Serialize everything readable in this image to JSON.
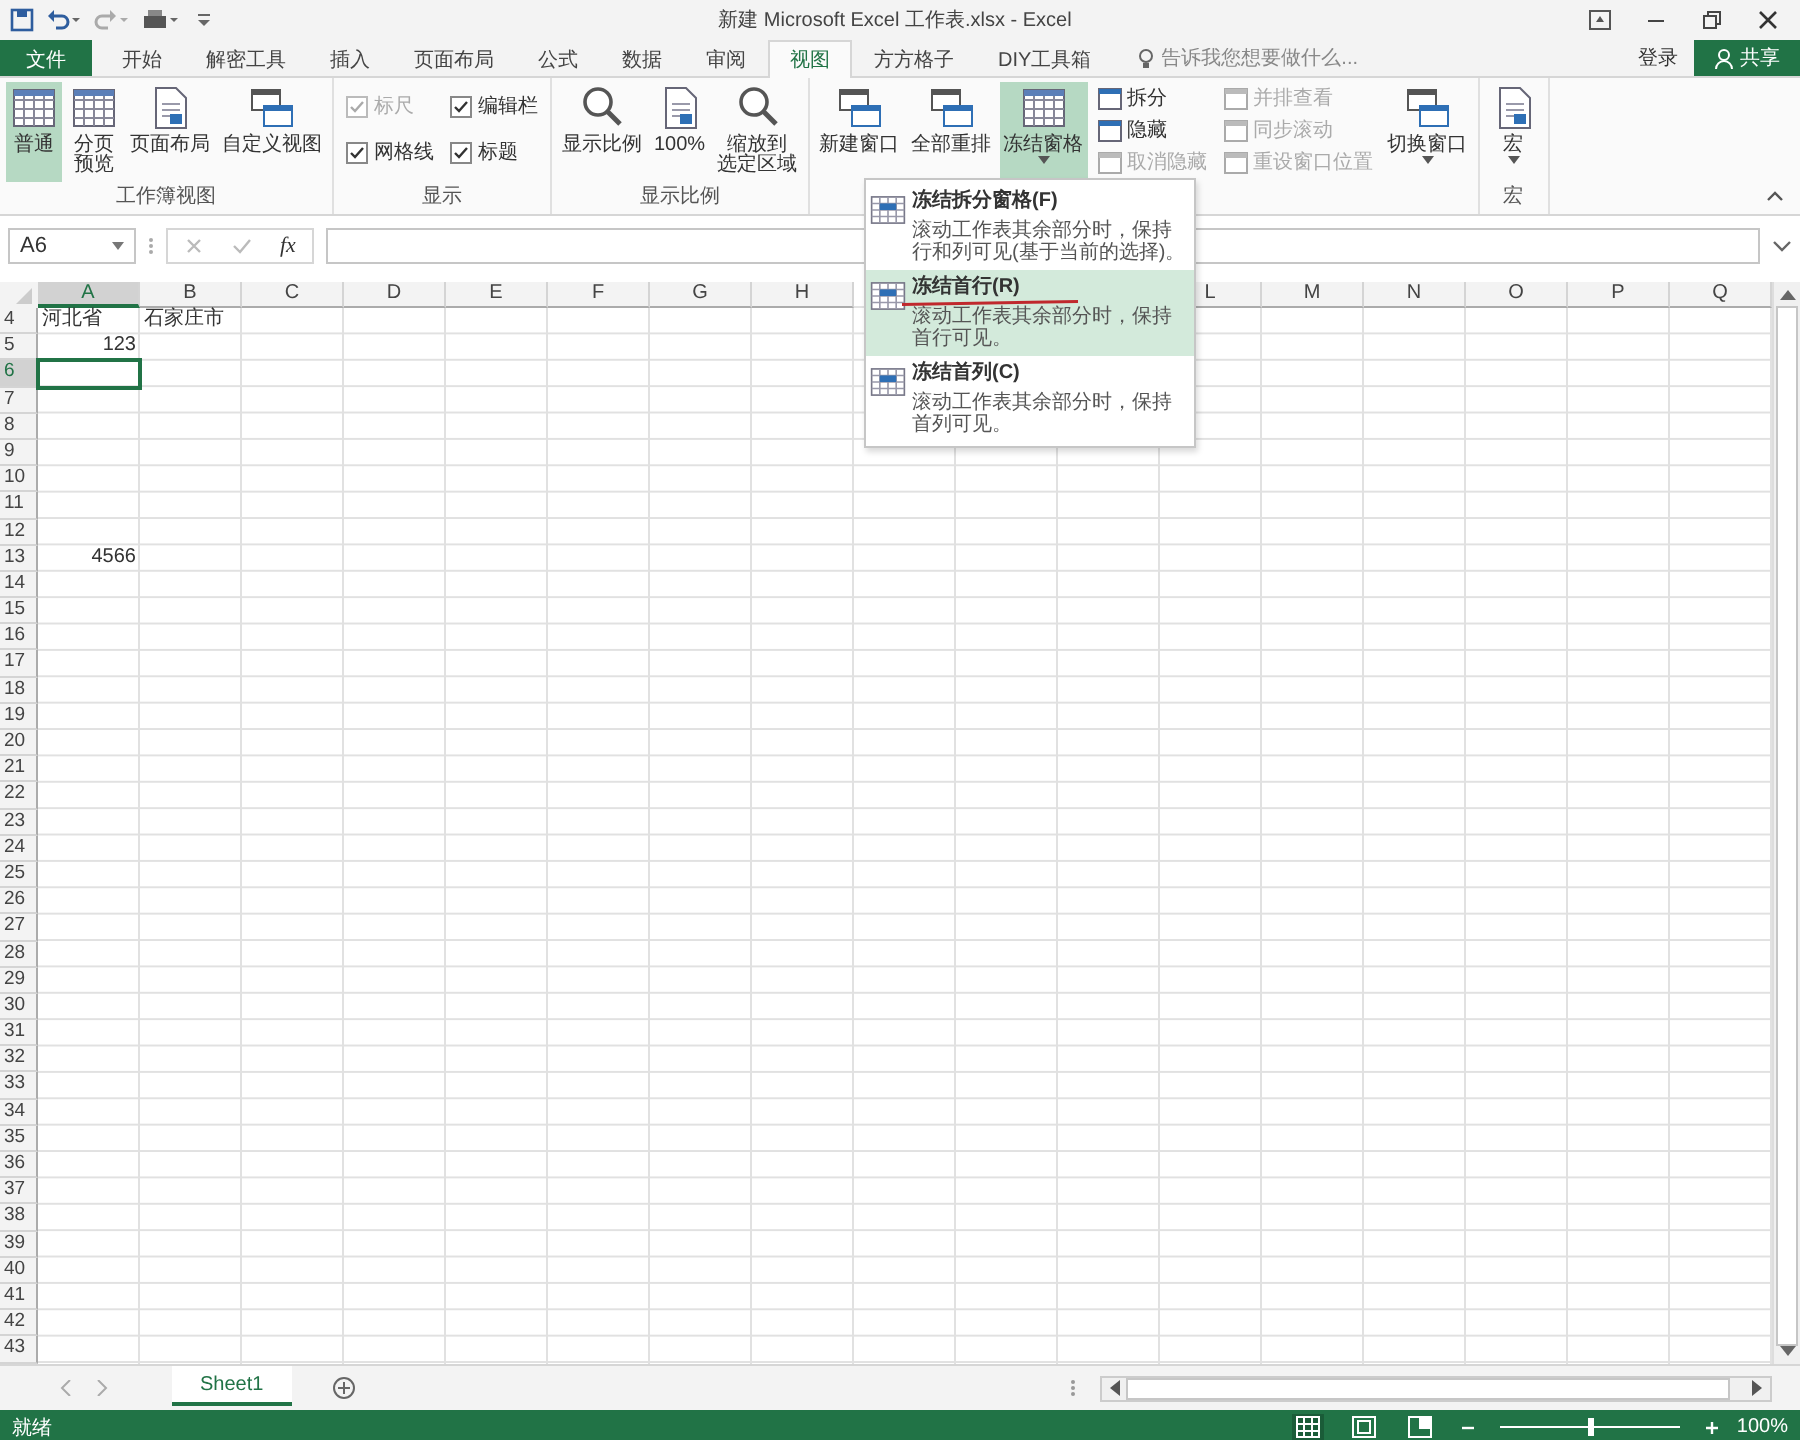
{
  "title_bar": {
    "title": "新建 Microsoft Excel 工作表.xlsx - Excel"
  },
  "tabs": [
    {
      "label": "文件",
      "kind": "file",
      "selected": false
    },
    {
      "label": "开始",
      "kind": "tab",
      "selected": false
    },
    {
      "label": "解密工具",
      "kind": "tab",
      "selected": false
    },
    {
      "label": "插入",
      "kind": "tab",
      "selected": false
    },
    {
      "label": "页面布局",
      "kind": "tab",
      "selected": false
    },
    {
      "label": "公式",
      "kind": "tab",
      "selected": false
    },
    {
      "label": "数据",
      "kind": "tab",
      "selected": false
    },
    {
      "label": "审阅",
      "kind": "tab",
      "selected": false
    },
    {
      "label": "视图",
      "kind": "tab",
      "selected": true
    },
    {
      "label": "方方格子",
      "kind": "tab",
      "selected": false
    },
    {
      "label": "DIY工具箱",
      "kind": "tab",
      "selected": false
    }
  ],
  "tell_me": {
    "placeholder": "告诉我您想要做什么..."
  },
  "sign_in": "登录",
  "share": "共享",
  "ribbon": {
    "groups": [
      {
        "label": "工作簿视图",
        "controls": [
          {
            "kind": "large",
            "lines": [
              "普通"
            ],
            "selected": true
          },
          {
            "kind": "large",
            "lines": [
              "分页",
              "预览"
            ],
            "selected": false
          },
          {
            "kind": "large",
            "lines": [
              "页面布局"
            ],
            "selected": false
          },
          {
            "kind": "large",
            "lines": [
              "自定义视图"
            ],
            "selected": false
          }
        ]
      },
      {
        "label": "显示",
        "controls": [
          {
            "kind": "checks",
            "items": [
              {
                "label": "标尺",
                "checked": true,
                "disabled": true
              },
              {
                "label": "网格线",
                "checked": true,
                "disabled": false
              }
            ]
          },
          {
            "kind": "checks",
            "items": [
              {
                "label": "编辑栏",
                "checked": true,
                "disabled": false
              },
              {
                "label": "标题",
                "checked": true,
                "disabled": false
              }
            ]
          }
        ]
      },
      {
        "label": "显示比例",
        "controls": [
          {
            "kind": "large",
            "lines": [
              "显示比例"
            ],
            "selected": false
          },
          {
            "kind": "large",
            "lines": [
              "100%"
            ],
            "selected": false
          },
          {
            "kind": "large",
            "lines": [
              "缩放到",
              "选定区域"
            ],
            "selected": false
          }
        ]
      },
      {
        "controls": [
          {
            "kind": "large",
            "lines": [
              "新建窗口"
            ],
            "selected": false
          },
          {
            "kind": "large",
            "lines": [
              "全部重排"
            ],
            "selected": false
          },
          {
            "kind": "large",
            "lines": [
              "冻结窗格"
            ],
            "selected": true,
            "dropdown": true
          },
          {
            "kind": "stack",
            "items": [
              {
                "label": "拆分",
                "disabled": false
              },
              {
                "label": "隐藏",
                "disabled": false
              },
              {
                "label": "取消隐藏",
                "disabled": true
              }
            ]
          },
          {
            "kind": "stack",
            "items": [
              {
                "label": "并排查看",
                "disabled": true
              },
              {
                "label": "同步滚动",
                "disabled": true
              },
              {
                "label": "重设窗口位置",
                "disabled": true
              }
            ]
          },
          {
            "kind": "large",
            "lines": [
              "切换窗口"
            ],
            "selected": false,
            "dropdown": true
          }
        ]
      },
      {
        "label": "宏",
        "controls": [
          {
            "kind": "large",
            "lines": [
              "宏"
            ],
            "selected": false,
            "dropdown": true
          }
        ]
      }
    ]
  },
  "freeze_menu": {
    "items": [
      {
        "title": "冻结拆分窗格(F)",
        "description": "滚动工作表其余部分时，保持行和列可见(基于当前的选择)。",
        "selected": false
      },
      {
        "title": "冻结首行(R)",
        "description": "滚动工作表其余部分时，保持首行可见。",
        "selected": true
      },
      {
        "title": "冻结首列(C)",
        "description": "滚动工作表其余部分时，保持首列可见。",
        "selected": false
      }
    ]
  },
  "formula_bar": {
    "name_box": "A6",
    "function_label": "fx"
  },
  "sheet": {
    "columns": [
      {
        "label": "A",
        "selected": true
      },
      {
        "label": "B",
        "selected": false
      },
      {
        "label": "C",
        "selected": false
      },
      {
        "label": "D",
        "selected": false
      },
      {
        "label": "E",
        "selected": false
      },
      {
        "label": "F",
        "selected": false
      },
      {
        "label": "G",
        "selected": false
      },
      {
        "label": "H",
        "selected": false
      },
      {},
      {},
      {},
      {
        "label": "L",
        "selected": false
      },
      {
        "label": "M",
        "selected": false
      },
      {
        "label": "N",
        "selected": false
      },
      {
        "label": "O",
        "selected": false
      },
      {
        "label": "P",
        "selected": false
      },
      {
        "label": "Q",
        "selected": false
      }
    ],
    "rows": [
      {
        "label": "4",
        "selected": false,
        "cells": [
          {
            "text": "河北省",
            "kind": "text"
          },
          {
            "text": "石家庄市",
            "kind": "text"
          }
        ]
      },
      {
        "label": "5",
        "selected": false,
        "cells": [
          {
            "text": "123",
            "kind": "number"
          }
        ]
      },
      {
        "label": "6",
        "selected": true
      },
      {
        "label": "7",
        "selected": false
      },
      {
        "label": "8",
        "selected": false
      },
      {
        "label": "9",
        "selected": false
      },
      {
        "label": "10",
        "selected": false
      },
      {
        "label": "11",
        "selected": false
      },
      {
        "label": "12",
        "selected": false
      },
      {
        "label": "13",
        "selected": false,
        "cells": [
          {
            "text": "4566",
            "kind": "number"
          }
        ]
      },
      {
        "label": "14",
        "selected": false
      },
      {
        "label": "15",
        "selected": false
      },
      {
        "label": "16",
        "selected": false
      },
      {
        "label": "17",
        "selected": false
      },
      {
        "label": "18",
        "selected": false
      },
      {
        "label": "19",
        "selected": false
      },
      {
        "label": "20",
        "selected": false
      },
      {
        "label": "21",
        "selected": false
      },
      {
        "label": "22",
        "selected": false
      },
      {
        "label": "23",
        "selected": false
      },
      {
        "label": "24",
        "selected": false
      },
      {
        "label": "25",
        "selected": false
      },
      {
        "label": "26",
        "selected": false
      },
      {
        "label": "27",
        "selected": false
      },
      {
        "label": "28",
        "selected": false
      },
      {
        "label": "29",
        "selected": false
      },
      {
        "label": "30",
        "selected": false
      },
      {
        "label": "31",
        "selected": false
      },
      {
        "label": "32",
        "selected": false
      },
      {
        "label": "33",
        "selected": false
      },
      {
        "label": "34",
        "selected": false
      },
      {
        "label": "35",
        "selected": false
      },
      {
        "label": "36",
        "selected": false
      },
      {
        "label": "37",
        "selected": false
      },
      {
        "label": "38",
        "selected": false
      },
      {
        "label": "39",
        "selected": false
      },
      {
        "label": "40",
        "selected": false
      },
      {
        "label": "41",
        "selected": false
      },
      {
        "label": "42",
        "selected": false
      },
      {
        "label": "43",
        "selected": false
      }
    ]
  },
  "sheet_tabs": [
    {
      "label": "Sheet1",
      "selected": true
    }
  ],
  "status_bar": {
    "status": "就绪",
    "views": [
      {
        "selected": true
      },
      {
        "selected": false
      },
      {
        "selected": false
      }
    ],
    "zoom": {
      "level": 0.5,
      "reading": "100%"
    }
  }
}
